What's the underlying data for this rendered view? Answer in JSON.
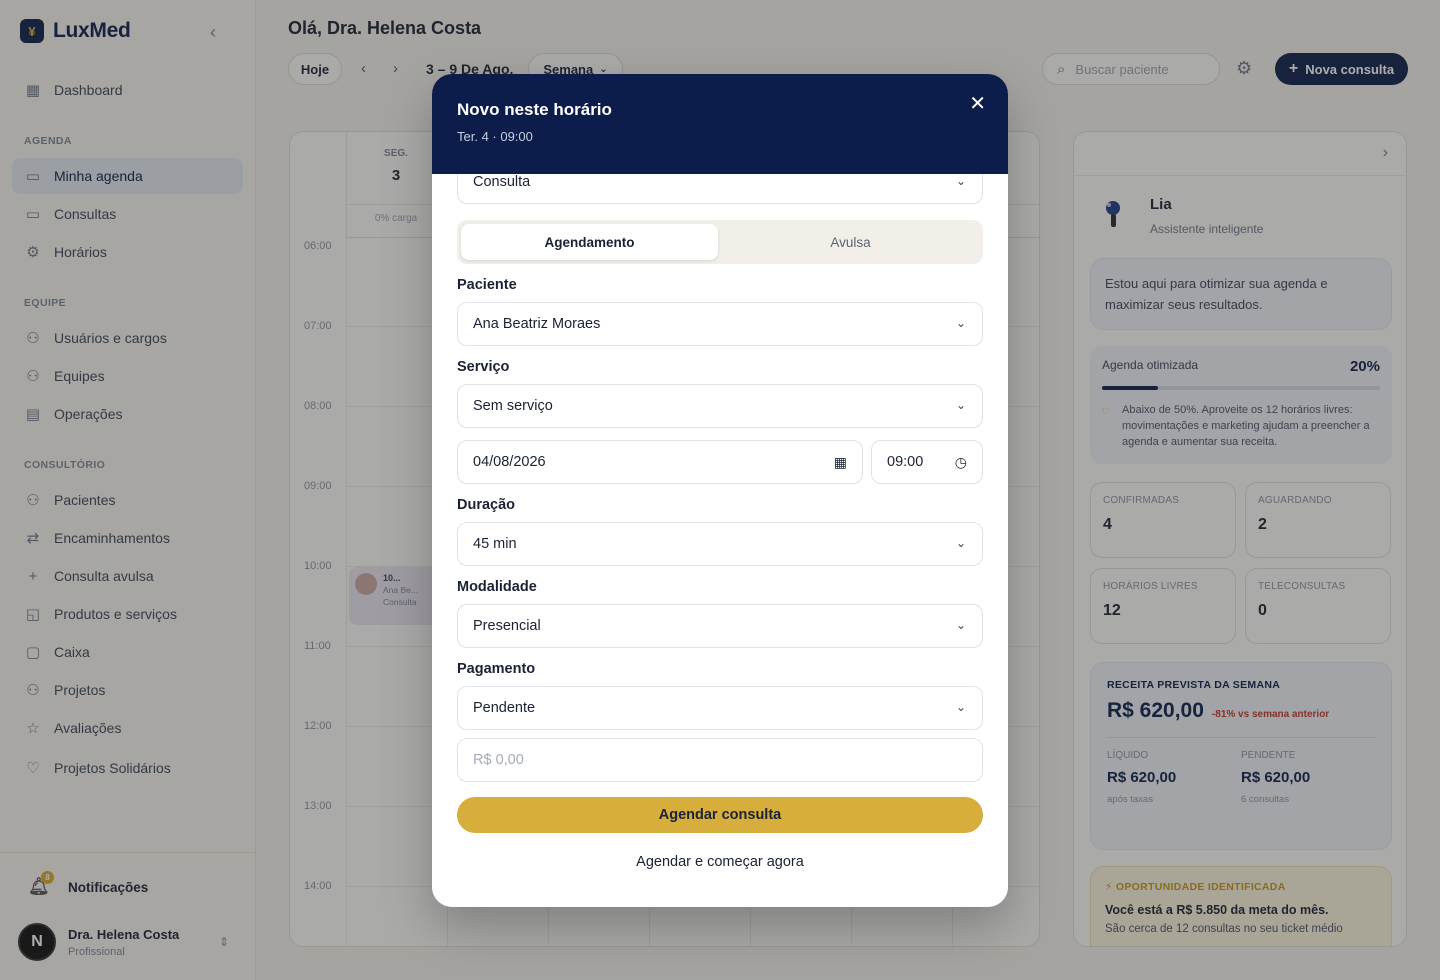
{
  "brand": {
    "name": "LuxMed",
    "logo_glyph": "¥"
  },
  "sidebar": {
    "top": [
      {
        "label": "Dashboard",
        "icon": "grid-icon"
      }
    ],
    "sections": [
      {
        "title": "AGENDA",
        "items": [
          {
            "label": "Minha agenda",
            "icon": "calendar-icon",
            "active": true
          },
          {
            "label": "Consultas",
            "icon": "calendar-clock-icon"
          },
          {
            "label": "Horários",
            "icon": "gear-icon"
          }
        ]
      },
      {
        "title": "EQUIPE",
        "items": [
          {
            "label": "Usuários e cargos",
            "icon": "users-icon"
          },
          {
            "label": "Equipes",
            "icon": "users-icon"
          },
          {
            "label": "Operações",
            "icon": "building-icon"
          }
        ]
      },
      {
        "title": "CONSULTÓRIO",
        "items": [
          {
            "label": "Pacientes",
            "icon": "users-icon"
          },
          {
            "label": "Encaminhamentos",
            "icon": "referral-icon"
          },
          {
            "label": "Consulta avulsa",
            "icon": "plus-icon"
          },
          {
            "label": "Produtos e serviços",
            "icon": "bag-icon"
          },
          {
            "label": "Caixa",
            "icon": "cashbox-icon"
          },
          {
            "label": "Projetos",
            "icon": "users-icon"
          },
          {
            "label": "Avaliações",
            "icon": "star-icon"
          },
          {
            "label": "Projetos Solidários",
            "icon": "heart-icon"
          }
        ]
      }
    ],
    "notifications": {
      "label": "Notificações",
      "count": "8"
    },
    "user": {
      "initial": "N",
      "name": "Dra. Helena Costa",
      "role": "Profissional"
    }
  },
  "header": {
    "greeting": "Olá, Dra. Helena Costa",
    "today_label": "Hoje",
    "range": "3 – 9 De Ago.",
    "view_label": "Semana",
    "search_placeholder": "Buscar paciente",
    "new_button": "Nova consulta"
  },
  "calendar": {
    "days": [
      {
        "name": "SEG.",
        "num": "3",
        "load": "0% carga"
      },
      {
        "name": "",
        "num": "",
        "load": ""
      },
      {
        "name": "",
        "num": "",
        "load": ""
      },
      {
        "name": "",
        "num": "",
        "load": ""
      },
      {
        "name": "",
        "num": "",
        "load": ""
      },
      {
        "name": "",
        "num": "",
        "load": ""
      },
      {
        "name": "",
        "num": "",
        "load": ""
      }
    ],
    "times": [
      "06:00",
      "07:00",
      "08:00",
      "09:00",
      "10:00",
      "11:00",
      "12:00",
      "13:00",
      "14:00"
    ],
    "event": {
      "title": "10...",
      "patient": "Ana Be...",
      "type": "Consulta"
    }
  },
  "assistant": {
    "name": "Lia",
    "subtitle": "Assistente inteligente",
    "message": "Estou aqui para otimizar sua agenda e maximizar seus resultados.",
    "optimized_label": "Agenda otimizada",
    "optimized_pct": "20%",
    "optimized_fraction": 0.2,
    "optimized_tip": "Abaixo de 50%. Aproveite os 12 horários livres: movimentações e marketing ajudam a preencher a agenda e aumentar sua receita."
  },
  "stats": [
    {
      "label": "CONFIRMADAS",
      "value": "4"
    },
    {
      "label": "AGUARDANDO",
      "value": "2"
    },
    {
      "label": "HORÁRIOS LIVRES",
      "value": "12"
    },
    {
      "label": "TELECONSULTAS",
      "value": "0"
    }
  ],
  "revenue": {
    "title": "RECEITA PREVISTA DA SEMANA",
    "amount": "R$ 620,00",
    "delta": "-81% vs semana anterior",
    "net_label": "LÍQUIDO",
    "net_value": "R$ 620,00",
    "net_note": "após taxas",
    "pending_label": "PENDENTE",
    "pending_value": "R$ 620,00",
    "pending_note": "6 consultas"
  },
  "opportunity": {
    "title": "OPORTUNIDADE IDENTIFICADA",
    "headline": "Você está a R$ 5.850 da meta do mês.",
    "body": "São cerca de 12 consultas no seu ticket médio"
  },
  "modal": {
    "title": "Novo neste horário",
    "subtitle": "Ter. 4 · 09:00",
    "type_value": "Consulta",
    "tabs": [
      "Agendamento",
      "Avulsa"
    ],
    "patient_label": "Paciente",
    "patient_value": "Ana Beatriz Moraes",
    "service_label": "Serviço",
    "service_value": "Sem serviço",
    "date_value": "04/08/2026",
    "time_value": "09:00",
    "duration_label": "Duração",
    "duration_value": "45 min",
    "modality_label": "Modalidade",
    "modality_value": "Presencial",
    "payment_label": "Pagamento",
    "payment_value": "Pendente",
    "amount_placeholder": "R$ 0,00",
    "primary_button": "Agendar consulta",
    "secondary_button": "Agendar e começar agora"
  },
  "colors": {
    "navy": "#0c1d4b",
    "gold": "#d7ad3b"
  }
}
